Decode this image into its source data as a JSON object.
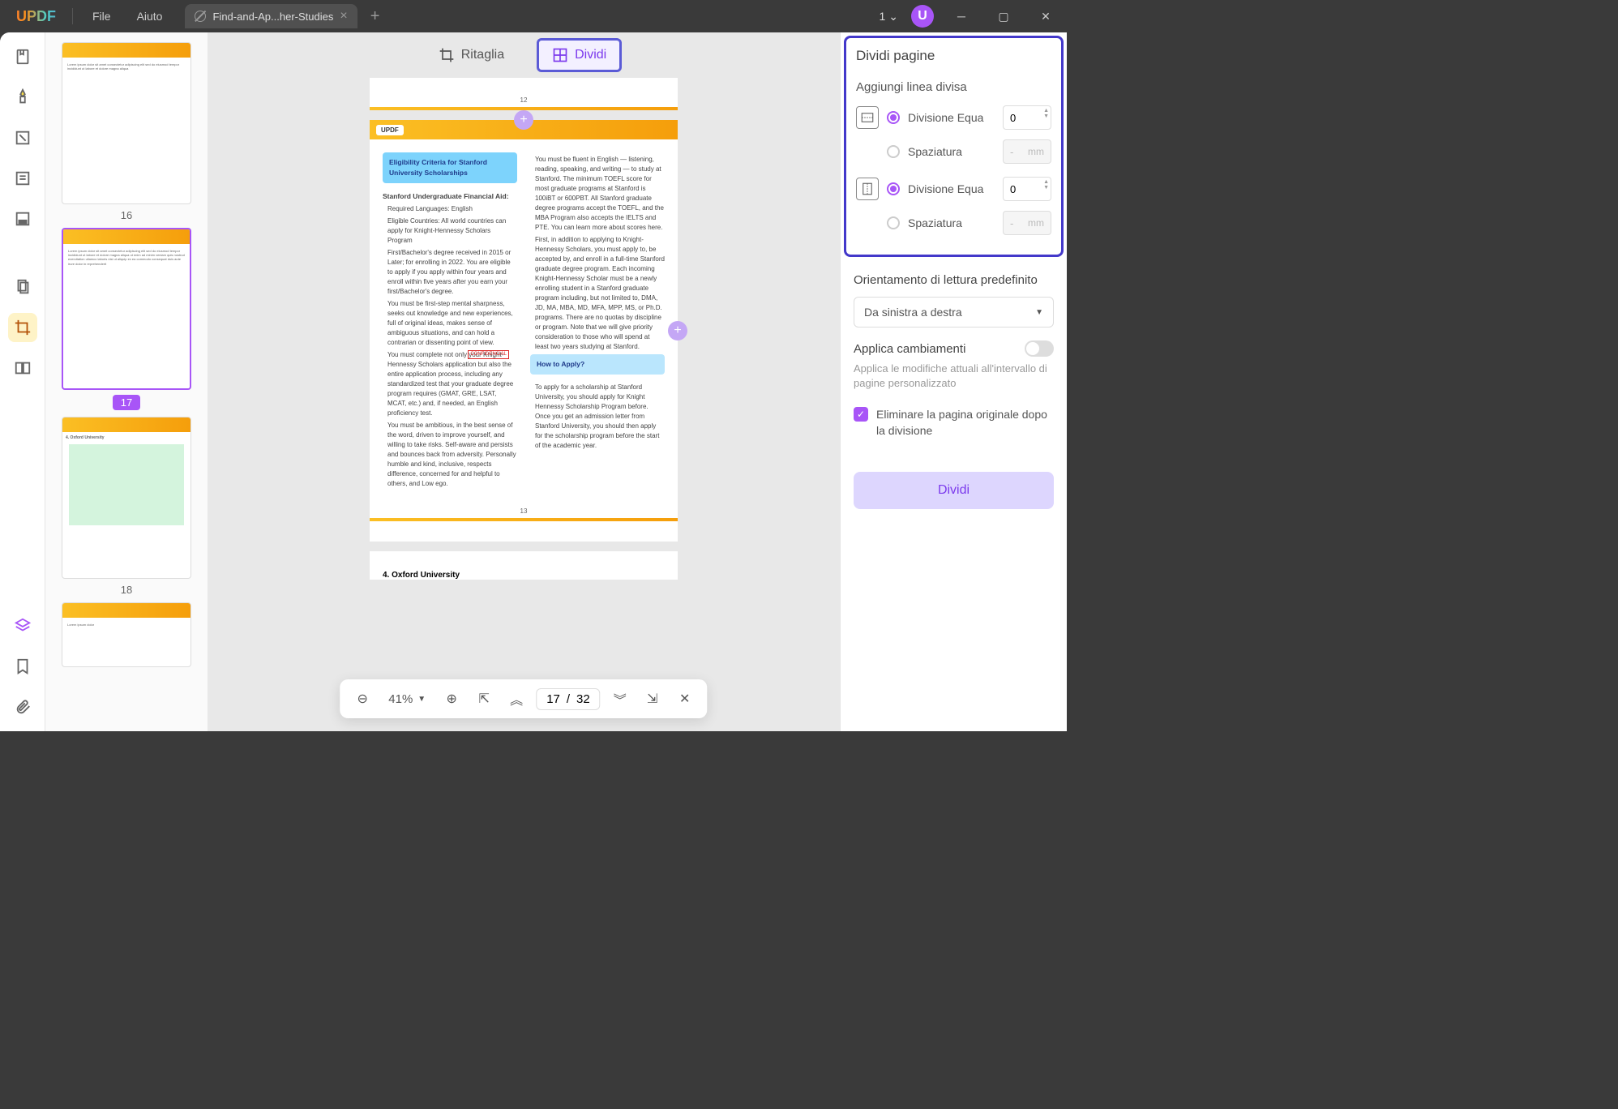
{
  "titlebar": {
    "logo": "UPDF",
    "menus": [
      "File",
      "Aiuto"
    ],
    "tab_title": "Find-and-Ap...her-Studies",
    "count": "1",
    "user_initial": "U"
  },
  "thumbnails": [
    {
      "num": "16",
      "selected": false
    },
    {
      "num": "17",
      "selected": true
    },
    {
      "num": "18",
      "selected": false
    }
  ],
  "center_toolbar": {
    "crop": "Ritaglia",
    "split": "Dividi"
  },
  "doc": {
    "prev_page_num": "12",
    "page_logo": "UPDF",
    "callout_title": "Eligibility Criteria for Stanford University Scholarships",
    "section1": "Stanford Undergraduate Financial Aid:",
    "bullets_left": [
      "Required Languages: English",
      "Eligible Countries: All world countries can apply for Knight-Hennessy Scholars Program",
      "First/Bachelor's degree received in 2015 or Later; for enrolling in 2022. You are eligible to apply if you apply within four years and enroll within five years after you earn your first/Bachelor's degree.",
      "You must be first-step mental sharpness, seeks out knowledge and new experiences, full of original ideas, makes sense of ambiguous situations, and can hold a contrarian or dissenting point of view.",
      "You must complete not only your Knight-Hennessy Scholars application but also the entire application process, including any standardized test that your graduate degree program requires (GMAT, GRE, LSAT, MCAT, etc.) and, if needed, an English proficiency test.",
      "You must be ambitious, in the best sense of the word, driven to improve yourself, and willing to take risks. Self-aware and persists and bounces back from adversity. Personally humble and kind, inclusive, respects difference, concerned for and helpful to others, and Low ego."
    ],
    "bullets_right": [
      "You must be fluent in English — listening, reading, speaking, and writing — to study at Stanford. The minimum TOEFL score for most graduate programs at Stanford is 100iBT or 600PBT. All Stanford graduate degree programs accept the TOEFL, and the MBA Program also accepts the IELTS and PTE. You can learn more about scores here.",
      "First, in addition to applying to Knight-Hennessy Scholars, you must apply to, be accepted by, and enroll in a full-time Stanford graduate degree program. Each incoming Knight-Hennessy Scholar must be a newly enrolling student in a Stanford graduate program including, but not limited to, DMA, JD, MA, MBA, MD, MFA, MPP, MS, or Ph.D. programs. There are no quotas by discipline or program. Note that we will give priority consideration to those who will spend at least two years studying at Stanford."
    ],
    "howto_title": "How to Apply?",
    "howto_text": "To apply for a scholarship at Stanford University, you should apply for Knight Hennessy Scholarship Program before. Once you get an admission letter from Stanford University, you should then apply for the scholarship program before the start of the academic year.",
    "page_num": "13",
    "next_heading": "4. Oxford University",
    "watermark": "CONFIDENCIAL"
  },
  "bottom_bar": {
    "zoom": "41%",
    "current_page": "17",
    "total_pages": "32"
  },
  "right_panel": {
    "title": "Dividi pagine",
    "add_line": "Aggiungi linea divisa",
    "equal_div": "Divisione Equa",
    "spacing": "Spaziatura",
    "value_zero": "0",
    "dash": "-",
    "unit": "mm",
    "reading_order": "Orientamento di lettura predefinito",
    "reading_value": "Da sinistra a destra",
    "apply_changes": "Applica cambiamenti",
    "apply_help": "Applica le modifiche attuali all'intervallo di pagine personalizzato",
    "delete_original": "Eliminare la pagina originale dopo la divisione",
    "split_action": "Dividi"
  }
}
